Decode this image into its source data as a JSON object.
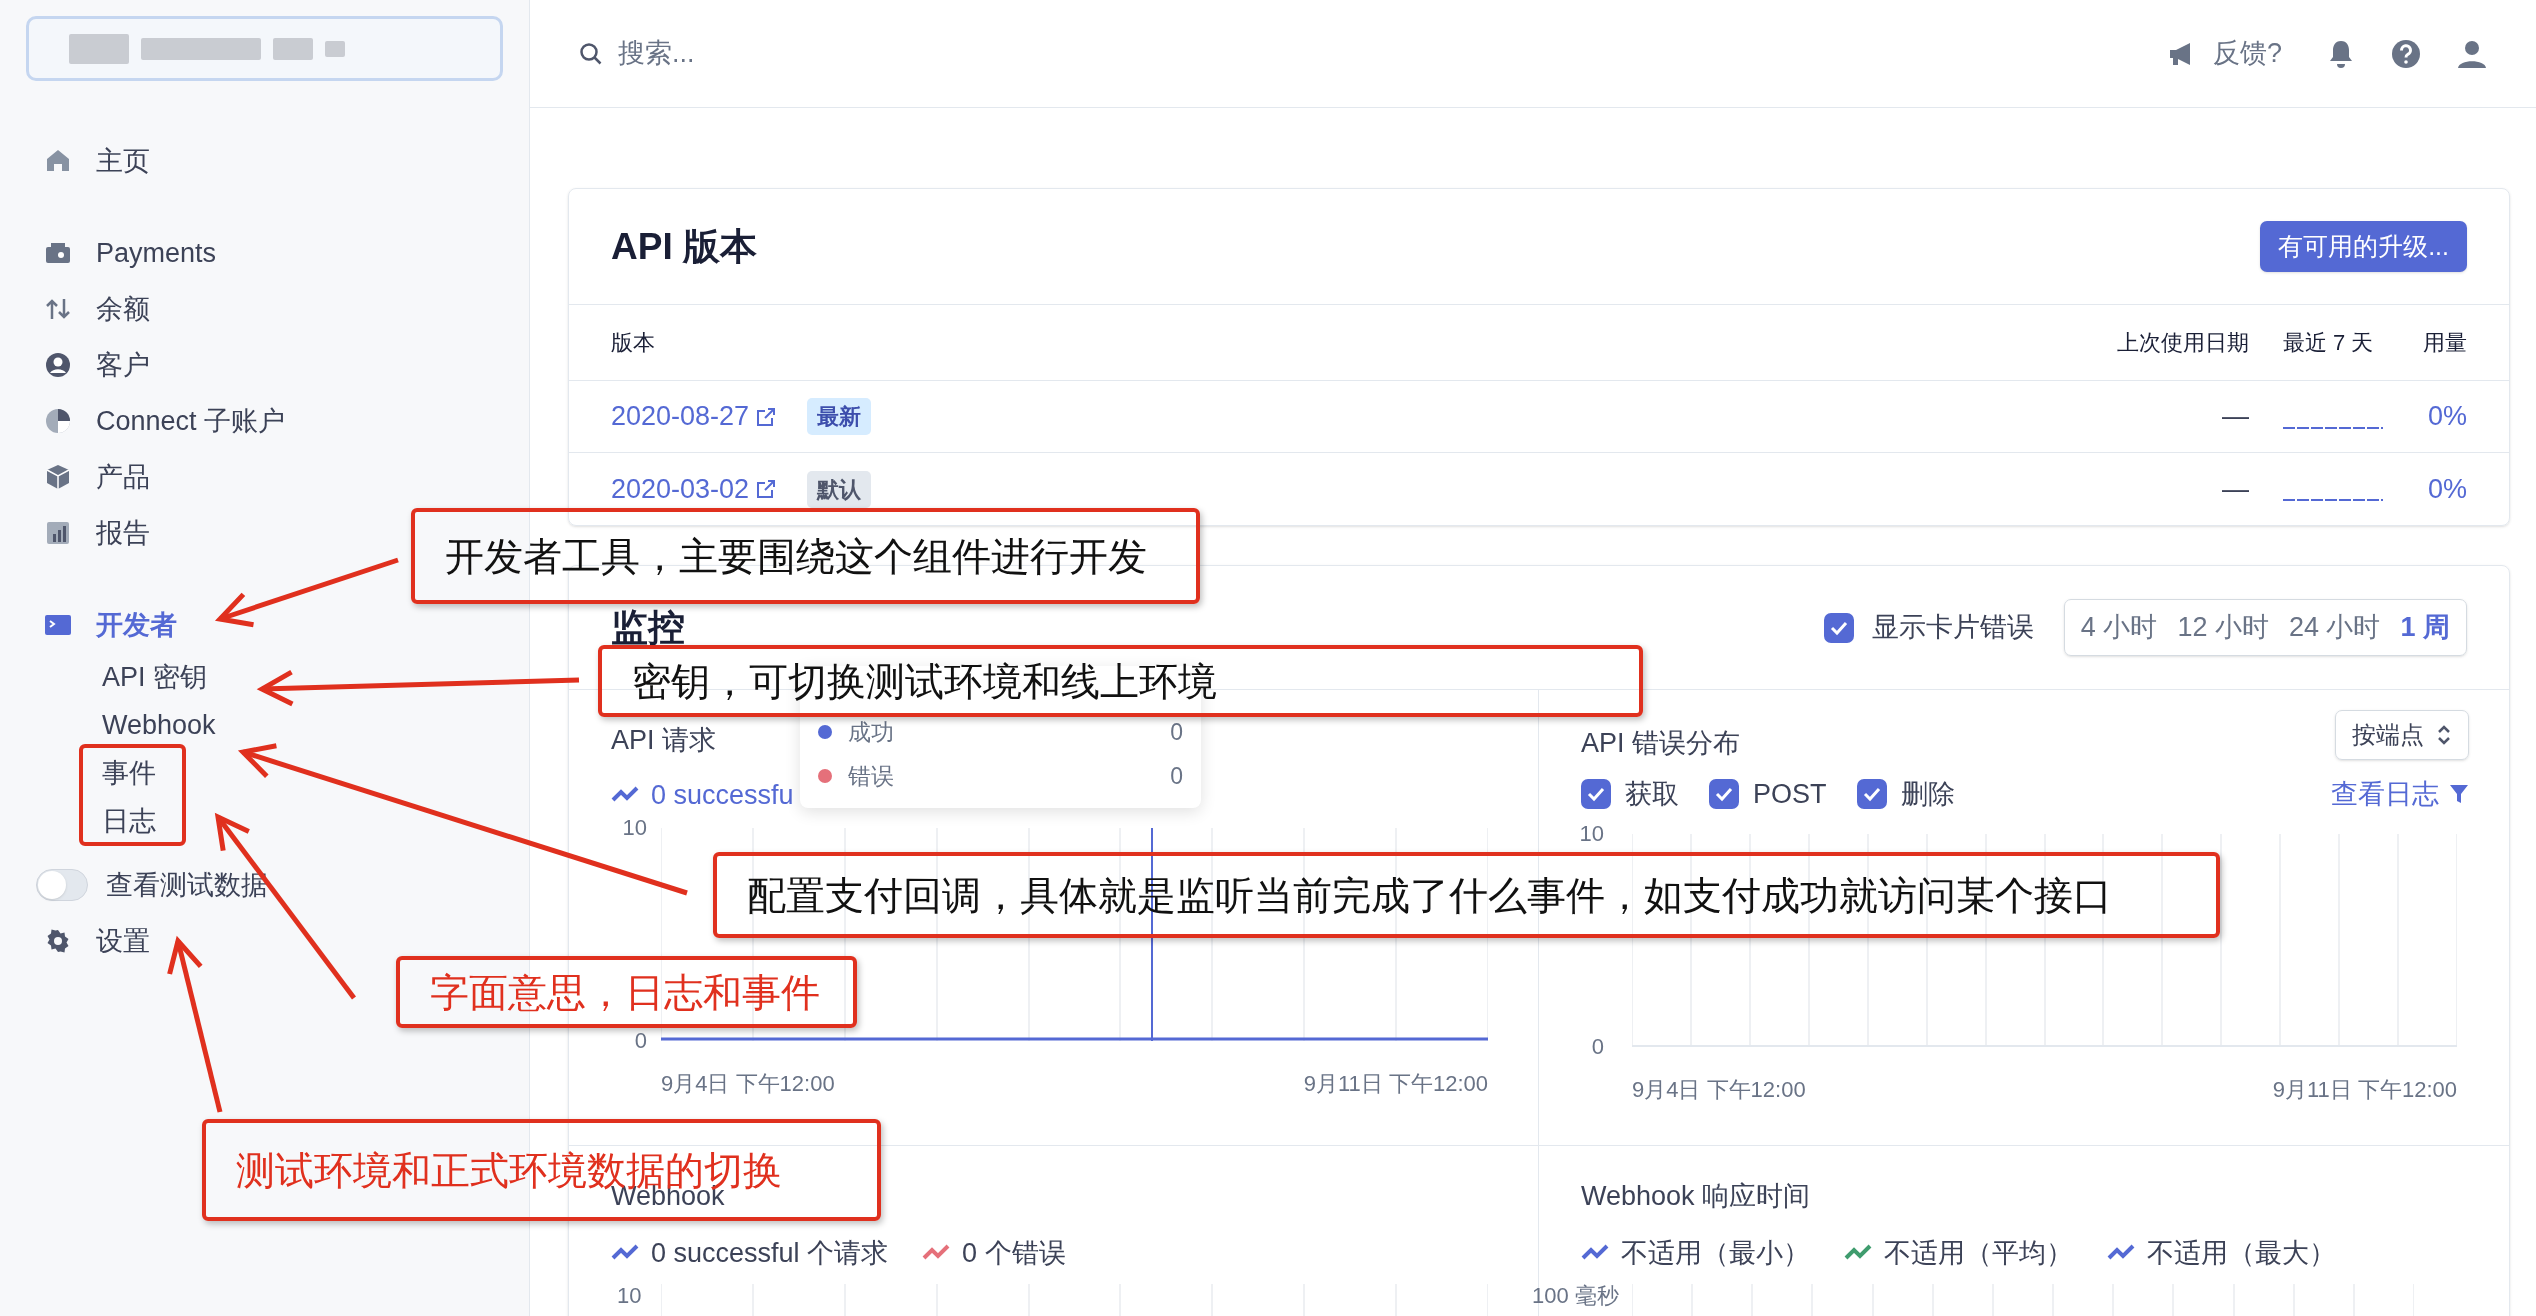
{
  "sidebar": {
    "nav_sections": [
      {
        "items": [
          {
            "label": "主页",
            "selected": false
          }
        ]
      },
      {
        "items": [
          {
            "label": "Payments",
            "selected": false
          },
          {
            "label": "余额",
            "selected": false
          },
          {
            "label": "客户",
            "selected": false
          },
          {
            "label": "Connect 子账户",
            "selected": false
          },
          {
            "label": "产品",
            "selected": false
          },
          {
            "label": "报告",
            "selected": false
          }
        ]
      },
      {
        "items": [
          {
            "label": "开发者",
            "selected": true,
            "children": [
              {
                "label": "API 密钥"
              },
              {
                "label": "Webhook"
              },
              {
                "label": "事件"
              },
              {
                "label": "日志"
              }
            ]
          }
        ]
      }
    ],
    "test_data_toggle": {
      "label": "查看测试数据",
      "on": false
    },
    "settings": {
      "label": "设置"
    }
  },
  "header": {
    "search": {
      "placeholder": "搜索..."
    },
    "feedback": "反馈?"
  },
  "api_versions": {
    "title": "API 版本",
    "upgrade_button": "有可用的升级...",
    "columns": [
      "版本",
      "上次使用日期",
      "最近 7 天",
      "用量"
    ],
    "rows": [
      {
        "version": "2020-08-27",
        "badge": "最新",
        "kind": "latest",
        "last_used": "—",
        "usage": "0%"
      },
      {
        "version": "2020-03-02",
        "badge": "默认",
        "kind": "default",
        "last_used": "—",
        "usage": "0%"
      }
    ]
  },
  "monitoring": {
    "title": "监控",
    "show_card_errors": {
      "label": "显示卡片错误",
      "checked": true
    },
    "ranges": [
      {
        "label": "4 小时",
        "selected": false
      },
      {
        "label": "12 小时",
        "selected": false
      },
      {
        "label": "24 小时",
        "selected": false
      },
      {
        "label": "1 周",
        "selected": true
      }
    ],
    "api_requests": {
      "title": "API 请求",
      "legend": [
        {
          "text": "0 successfu",
          "color": "#5469d4"
        }
      ],
      "tooltip": {
        "rows": [
          {
            "label": "成功",
            "value": "0",
            "color": "#5469d4"
          },
          {
            "label": "错误",
            "value": "0",
            "color": "#e5707a"
          }
        ]
      },
      "y_labels": [
        "10",
        "0"
      ],
      "x_labels": [
        "9月4日 下午12:00",
        "9月11日 下午12:00"
      ]
    },
    "api_errors": {
      "title": "API 错误分布",
      "group_by": "按端点",
      "methods": [
        {
          "label": "获取",
          "checked": true
        },
        {
          "label": "POST",
          "checked": true
        },
        {
          "label": "删除",
          "checked": true
        }
      ],
      "view_logs": "查看日志",
      "y_labels": [
        "10",
        "0"
      ],
      "x_labels": [
        "9月4日 下午12:00",
        "9月11日 下午12:00"
      ]
    },
    "webhook": {
      "title": "Webhook",
      "legend": [
        {
          "text": "0 successful 个请求",
          "color": "#5469d4"
        },
        {
          "text": "0 个错误",
          "color": "#e5707a"
        }
      ],
      "y_label": "10"
    },
    "webhook_response": {
      "title": "Webhook 响应时间",
      "legend": [
        {
          "text": "不适用（最小）",
          "color": "#5469d4"
        },
        {
          "text": "不适用（平均）",
          "color": "#3f9c6e"
        },
        {
          "text": "不适用（最大）",
          "color": "#5469d4"
        }
      ],
      "y_label": "100 毫秒"
    }
  },
  "annotations": [
    {
      "text": "开发者工具，主要围绕这个组件进行开发",
      "color": "#111111"
    },
    {
      "text": "密钥，可切换测试环境和线上环境",
      "color": "#111111"
    },
    {
      "text": "配置支付回调，具体就是监听当前完成了什么事件，如支付成功就访问某个接口",
      "color": "#111111"
    },
    {
      "text": "字面意思，日志和事件",
      "color": "#e0301e"
    },
    {
      "text": "测试环境和正式环境数据的切换",
      "color": "#e0301e"
    }
  ]
}
